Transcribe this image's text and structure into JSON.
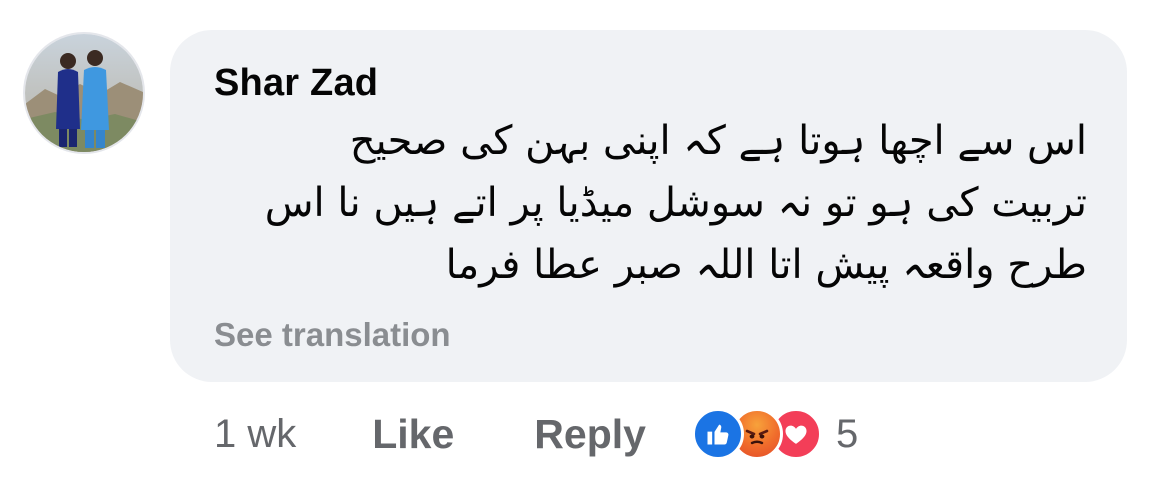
{
  "comment": {
    "author": "Shar Zad",
    "text_lines": [
      "اس سے اچھا ہوتا ہے کہ اپنی بہن کی صحیح",
      "تربیت کی ہو تو نہ سوشل میڈیا پر اتے ہیں نا اس",
      "طرح واقعہ پیش اتا اللہ صبر عطا فرما"
    ],
    "see_translation": "See translation"
  },
  "actions": {
    "timestamp": "1 wk",
    "like_label": "Like",
    "reply_label": "Reply"
  },
  "reactions": {
    "icons": [
      "like-icon",
      "angry-icon",
      "love-icon"
    ],
    "count": "5"
  },
  "colors": {
    "bubble_bg": "#f0f2f5",
    "author": "#050505",
    "secondary_text": "#65676b",
    "translation_link": "#8a8d91",
    "like_blue": "#1b74e4",
    "love_red": "#f33e58",
    "angry_orange": "#f06b2b"
  }
}
